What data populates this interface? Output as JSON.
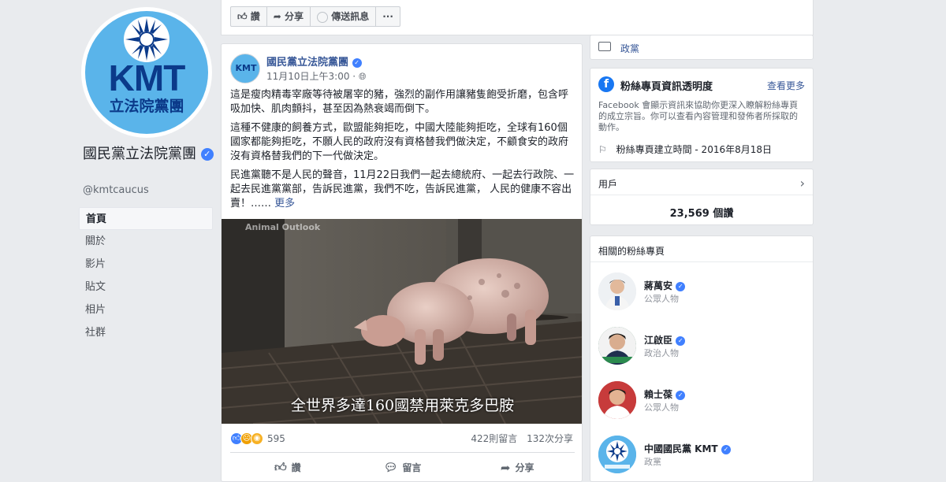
{
  "profile": {
    "avatar_main": "KMT",
    "avatar_sub": "立法院黨團",
    "name": "國民黨立法院黨團",
    "handle": "@kmtcaucus"
  },
  "nav": {
    "items": [
      "首頁",
      "關於",
      "影片",
      "貼文",
      "相片",
      "社群"
    ]
  },
  "topbar": {
    "like_label": "讚",
    "share_label": "分享",
    "message_label": "傳送訊息",
    "more_label": "···"
  },
  "post": {
    "author": "國民黨立法院黨團",
    "avatar_main": "KMT",
    "time": "11月10日上午3:00 · ",
    "para1": "這是瘦肉精毒宰廠等待被屠宰的豬，強烈的副作用讓豬隻飽受折磨，包含呼吸加快、肌肉顫抖，甚至因為熱衰竭而倒下。",
    "para2": "這種不健康的飼養方式，歐盟能夠拒吃，中國大陸能夠拒吃，全球有160個國家都能夠拒吃，不願人民的政府沒有資格替我們做決定，不顧食安的政府沒有資格替我們的下一代做決定。",
    "para3": "民進黨聽不是人民的聲音，11月22日我們一起去總統府、一起去行政院、一起去民進黨黨部，告訴民進黨，我們不吃，告訴民進黨， 人民的健康不容出賣！……",
    "more_label": "更多",
    "video_watermark": "Animal Outlook",
    "video_caption": "全世界多達160國禁用萊克多巴胺",
    "reaction_count": "595",
    "comments": "422則留言",
    "shares": "132次分享",
    "action_like": "讚",
    "action_comment": "留言",
    "action_share": "分享"
  },
  "sidebar": {
    "category": "政黨",
    "transparency_title": "粉絲專頁資訊透明度",
    "see_more": "查看更多",
    "transparency_text": "Facebook 會顯示資訊來協助你更深入瞭解粉絲專頁的成立宗旨。你可以查看內容管理和發佈者所採取的動作。",
    "created": "粉絲專頁建立時間 - 2016年8月18日",
    "users_title": "用戶",
    "users_count": "23,569 個讚",
    "related_title": "相關的粉絲專頁",
    "related": [
      {
        "name": "蔣萬安",
        "role": "公眾人物"
      },
      {
        "name": "江啟臣",
        "role": "政治人物"
      },
      {
        "name": "賴士葆",
        "role": "公眾人物"
      },
      {
        "name": "中國國民黨 KMT",
        "role": "政黨"
      }
    ]
  }
}
